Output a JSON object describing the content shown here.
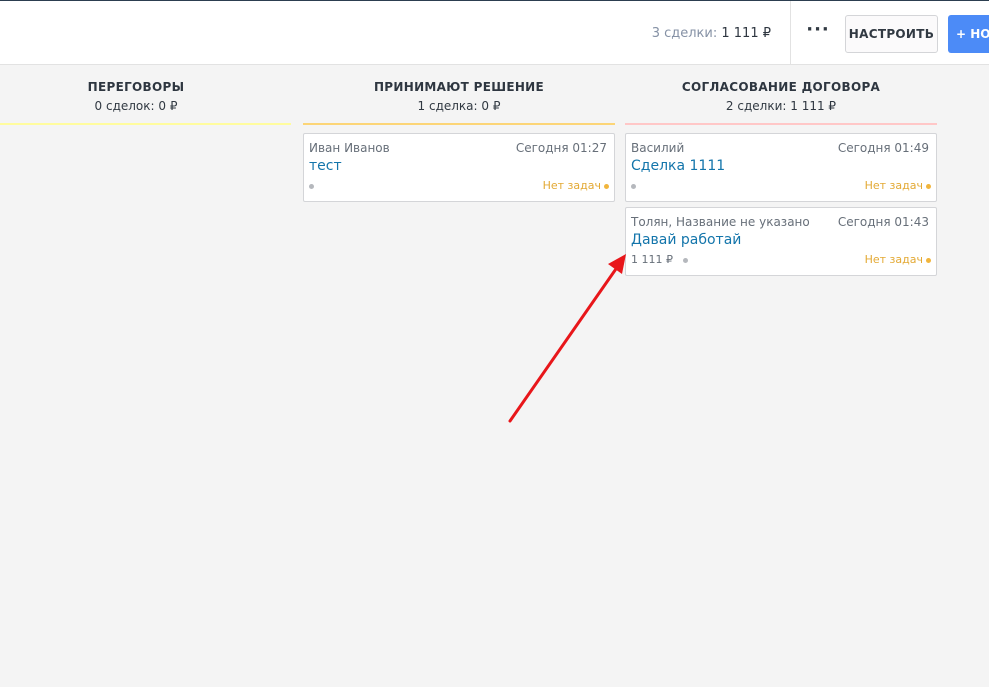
{
  "header": {
    "summary_count": "3 сделки:",
    "summary_amount": "1 111 ₽",
    "more_label": "···",
    "config_label": "НАСТРОИТЬ",
    "new_label": "+ НО"
  },
  "columns": [
    {
      "title": "ПЕРЕГОВОРЫ",
      "meta_prefix": "0 сделок:",
      "meta_amount": "0 ₽",
      "color": "#fffc9e"
    },
    {
      "title": "ПРИНИМАЮТ РЕШЕНИЕ",
      "meta_prefix": "1 сделка:",
      "meta_amount": "0 ₽",
      "color": "#fcd577"
    },
    {
      "title": "СОГЛАСОВАНИЕ ДОГОВОРА",
      "meta_prefix": "2 сделки:",
      "meta_amount": "1 111 ₽",
      "color": "#ffc7c7"
    }
  ],
  "cards": [
    {
      "contact": "Иван Иванов",
      "time": "Сегодня 01:27",
      "title": "тест",
      "price": "",
      "tasks": "Нет задач"
    },
    {
      "contact": "Василий",
      "time": "Сегодня 01:49",
      "title": "Сделка 1111",
      "price": "",
      "tasks": "Нет задач"
    },
    {
      "contact": "Толян, Название не указано",
      "time": "Сегодня 01:43",
      "title": "Давай работай",
      "price": "1 111 ₽",
      "tasks": "Нет задач"
    }
  ],
  "annotation_color": "#e8161a"
}
